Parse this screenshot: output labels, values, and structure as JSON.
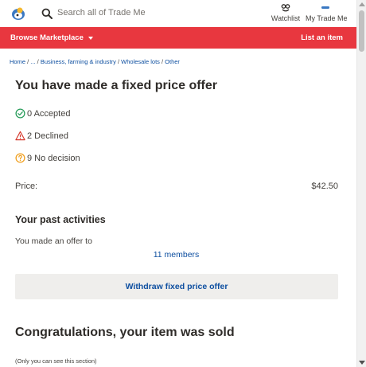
{
  "header": {
    "search_placeholder": "Search all of Trade Me",
    "watchlist_label": "Watchlist",
    "my_trade_me_label": "My Trade Me"
  },
  "nav": {
    "browse_label": "Browse Marketplace",
    "list_label": "List an item"
  },
  "breadcrumb": {
    "items": [
      "Home",
      "...",
      "Business, farming & industry",
      "Wholesale lots",
      "Other"
    ]
  },
  "offer": {
    "title": "You have made a fixed price offer",
    "accepted": "0 Accepted",
    "declined": "2 Declined",
    "no_decision": "9 No decision",
    "price_label": "Price:",
    "price_value": "$42.50"
  },
  "activities": {
    "title": "Your past activities",
    "offer_text": "You made an offer to",
    "members_link": "11 members",
    "withdraw_label": "Withdraw fixed price offer"
  },
  "sold": {
    "title": "Congratulations, your item was sold",
    "note": "(Only you can see this section)"
  },
  "colors": {
    "brand_red": "#e8373f",
    "link_blue": "#0e4fa0",
    "accepted_green": "#2a9d5c",
    "declined_red": "#d63b2f",
    "nodecision_orange": "#f0a020"
  },
  "icons": [
    "trademe-logo-icon",
    "search-icon",
    "watchlist-icon",
    "my-trade-me-icon",
    "chevron-down-icon",
    "check-circle-icon",
    "warning-triangle-icon",
    "question-circle-icon"
  ]
}
